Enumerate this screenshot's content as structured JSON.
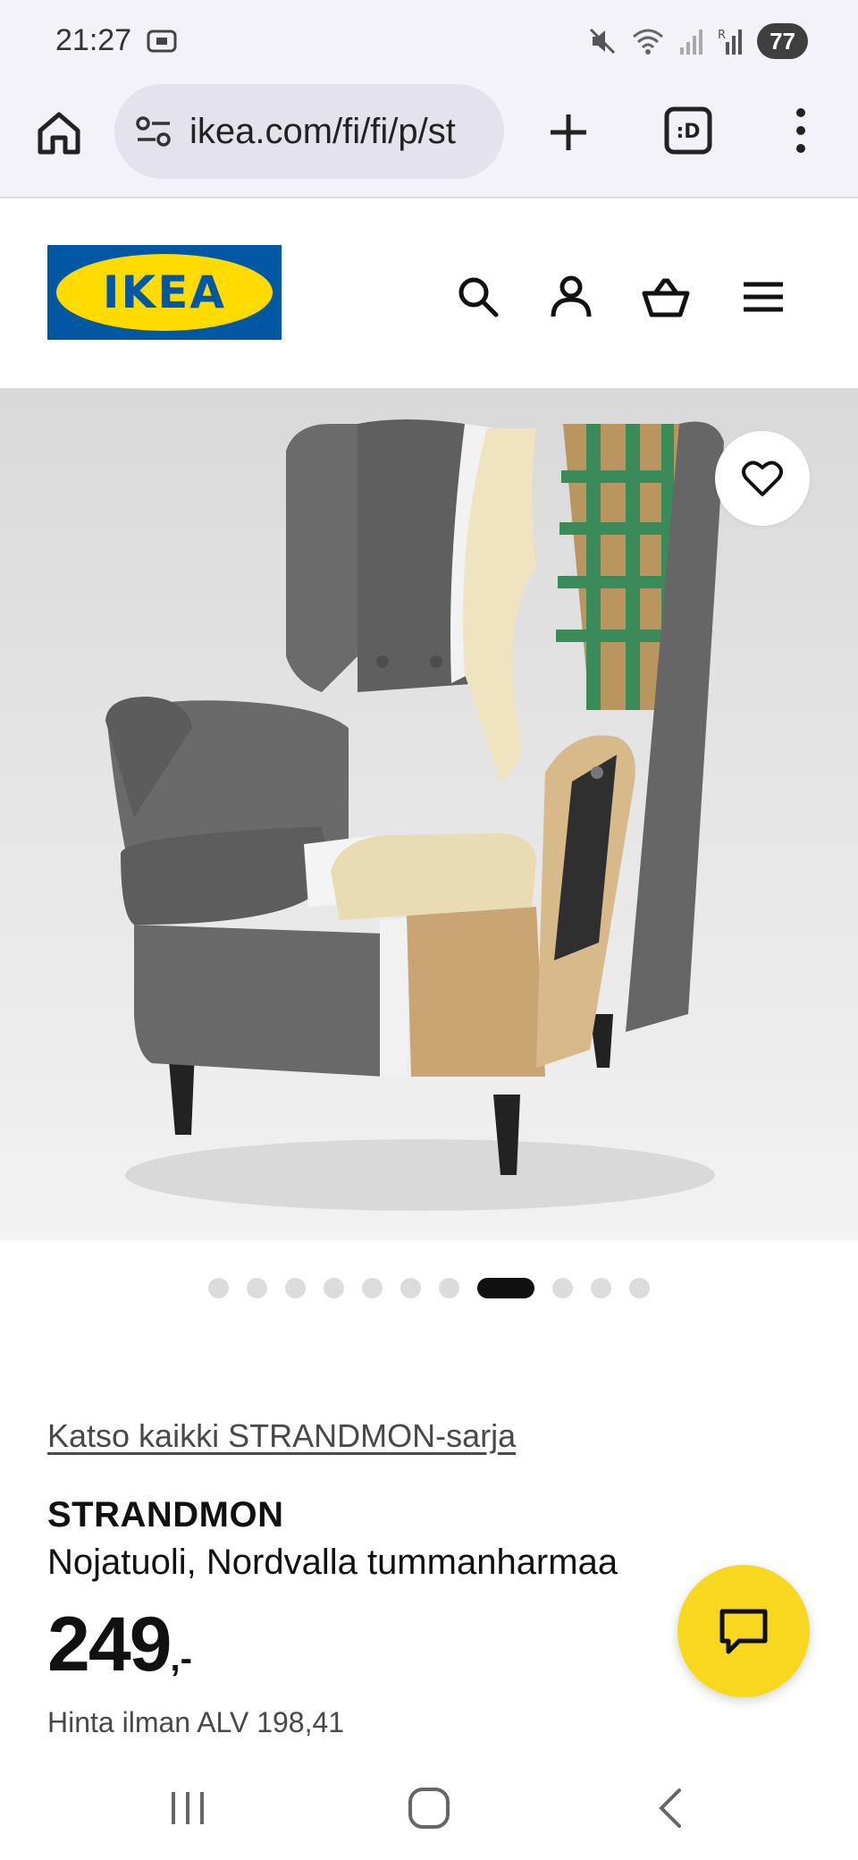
{
  "status_bar": {
    "time": "21:27",
    "battery": "77",
    "icons": [
      "screenshot-icon",
      "mute-icon",
      "wifi-icon",
      "signal-icon",
      "signal-r-icon"
    ]
  },
  "browser": {
    "url": "ikea.com/fi/fi/p/st",
    "icons": [
      "home-icon",
      "site-settings-icon",
      "new-tab-plus-icon",
      "tab-switcher-icon",
      "more-menu-icon"
    ]
  },
  "site_header": {
    "logo_text": "IKEA",
    "icons": [
      "search-icon",
      "account-icon",
      "cart-icon",
      "menu-icon"
    ]
  },
  "gallery": {
    "dot_count": 11,
    "active_index": 7
  },
  "product": {
    "series_link": "Katso kaikki STRANDMON-sarja",
    "name": "STRANDMON",
    "description": "Nojatuoli, Nordvalla tummanharmaa",
    "price_integer": "249",
    "price_suffix": ",-",
    "price_note": "Hinta ilman ALV 198,41"
  },
  "colors": {
    "ikea_blue": "#0058a3",
    "ikea_yellow": "#ffdb00",
    "chat_yellow": "#f7d81e",
    "text_dark": "#111111",
    "text_muted": "#484848"
  }
}
